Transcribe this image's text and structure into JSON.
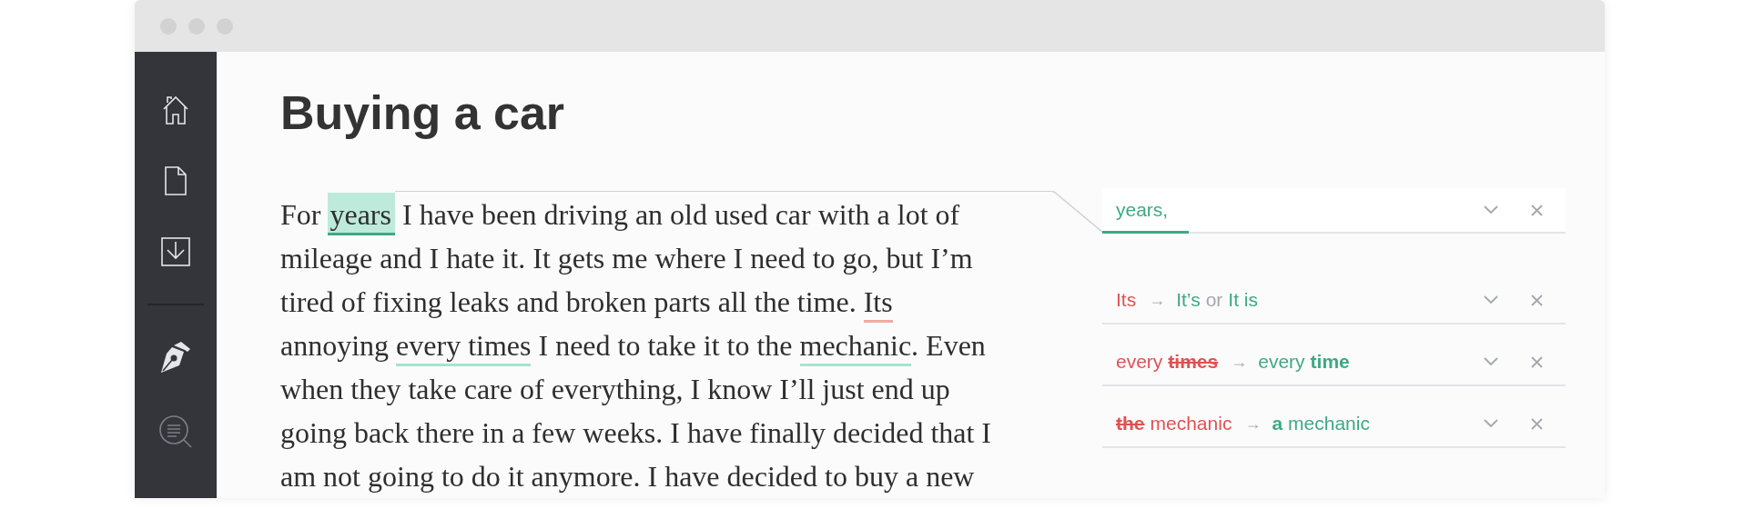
{
  "document": {
    "title": "Buying a car",
    "lines": [
      [
        {
          "text": "For ",
          "kind": "plain"
        },
        {
          "text": "years",
          "kind": "suggestion",
          "selected": true
        },
        {
          "text": " I have been driving an old used car with a lot of",
          "kind": "plain"
        }
      ],
      [
        {
          "text": "mileage and I hate it. It gets me where I need to go, but I’m",
          "kind": "plain"
        }
      ],
      [
        {
          "text": "tired of fixing leaks and broken parts all the time. ",
          "kind": "plain"
        },
        {
          "text": "Its",
          "kind": "error",
          "selected": false
        }
      ],
      [
        {
          "text": "annoying ",
          "kind": "plain"
        },
        {
          "text": "every times",
          "kind": "suggestion",
          "selected": false
        },
        {
          "text": " I need to take it to the ",
          "kind": "plain"
        },
        {
          "text": "mechanic",
          "kind": "suggestion",
          "selected": false
        },
        {
          "text": ". Even",
          "kind": "plain"
        }
      ],
      [
        {
          "text": "when they take care of everything, I know I’ll just end up",
          "kind": "plain"
        }
      ],
      [
        {
          "text": "going back there in a few weeks. I have finally decided that I",
          "kind": "plain"
        }
      ],
      [
        {
          "text": "am not going to do it anymore. I have decided to buy a new",
          "kind": "plain"
        }
      ]
    ]
  },
  "suggestions": [
    {
      "selected": true,
      "parts": [
        {
          "text": "years,",
          "kind": "fix",
          "bold": false,
          "strike": false
        }
      ]
    },
    {
      "selected": false,
      "parts": [
        {
          "text": "Its",
          "kind": "error",
          "bold": false,
          "strike": false
        },
        {
          "text": "→",
          "kind": "arrow",
          "bold": false,
          "strike": false
        },
        {
          "text": "It’s",
          "kind": "fix",
          "bold": false,
          "strike": false
        },
        {
          "text": "or",
          "kind": "neutral",
          "bold": false,
          "strike": false
        },
        {
          "text": "It is",
          "kind": "fix",
          "bold": false,
          "strike": false
        }
      ]
    },
    {
      "selected": false,
      "parts": [
        {
          "text": "every",
          "kind": "error",
          "bold": false,
          "strike": false
        },
        {
          "text": "times",
          "kind": "error",
          "bold": true,
          "strike": true
        },
        {
          "text": "→",
          "kind": "arrow",
          "bold": false,
          "strike": false
        },
        {
          "text": "every",
          "kind": "fix",
          "bold": false,
          "strike": false
        },
        {
          "text": "time",
          "kind": "fix",
          "bold": true,
          "strike": false
        }
      ]
    },
    {
      "selected": false,
      "parts": [
        {
          "text": "the",
          "kind": "error",
          "bold": true,
          "strike": true
        },
        {
          "text": "mechanic",
          "kind": "error",
          "bold": false,
          "strike": false
        },
        {
          "text": "→",
          "kind": "arrow",
          "bold": false,
          "strike": false
        },
        {
          "text": "a",
          "kind": "fix",
          "bold": true,
          "strike": false
        },
        {
          "text": "mechanic",
          "kind": "fix",
          "bold": false,
          "strike": false
        }
      ]
    }
  ]
}
